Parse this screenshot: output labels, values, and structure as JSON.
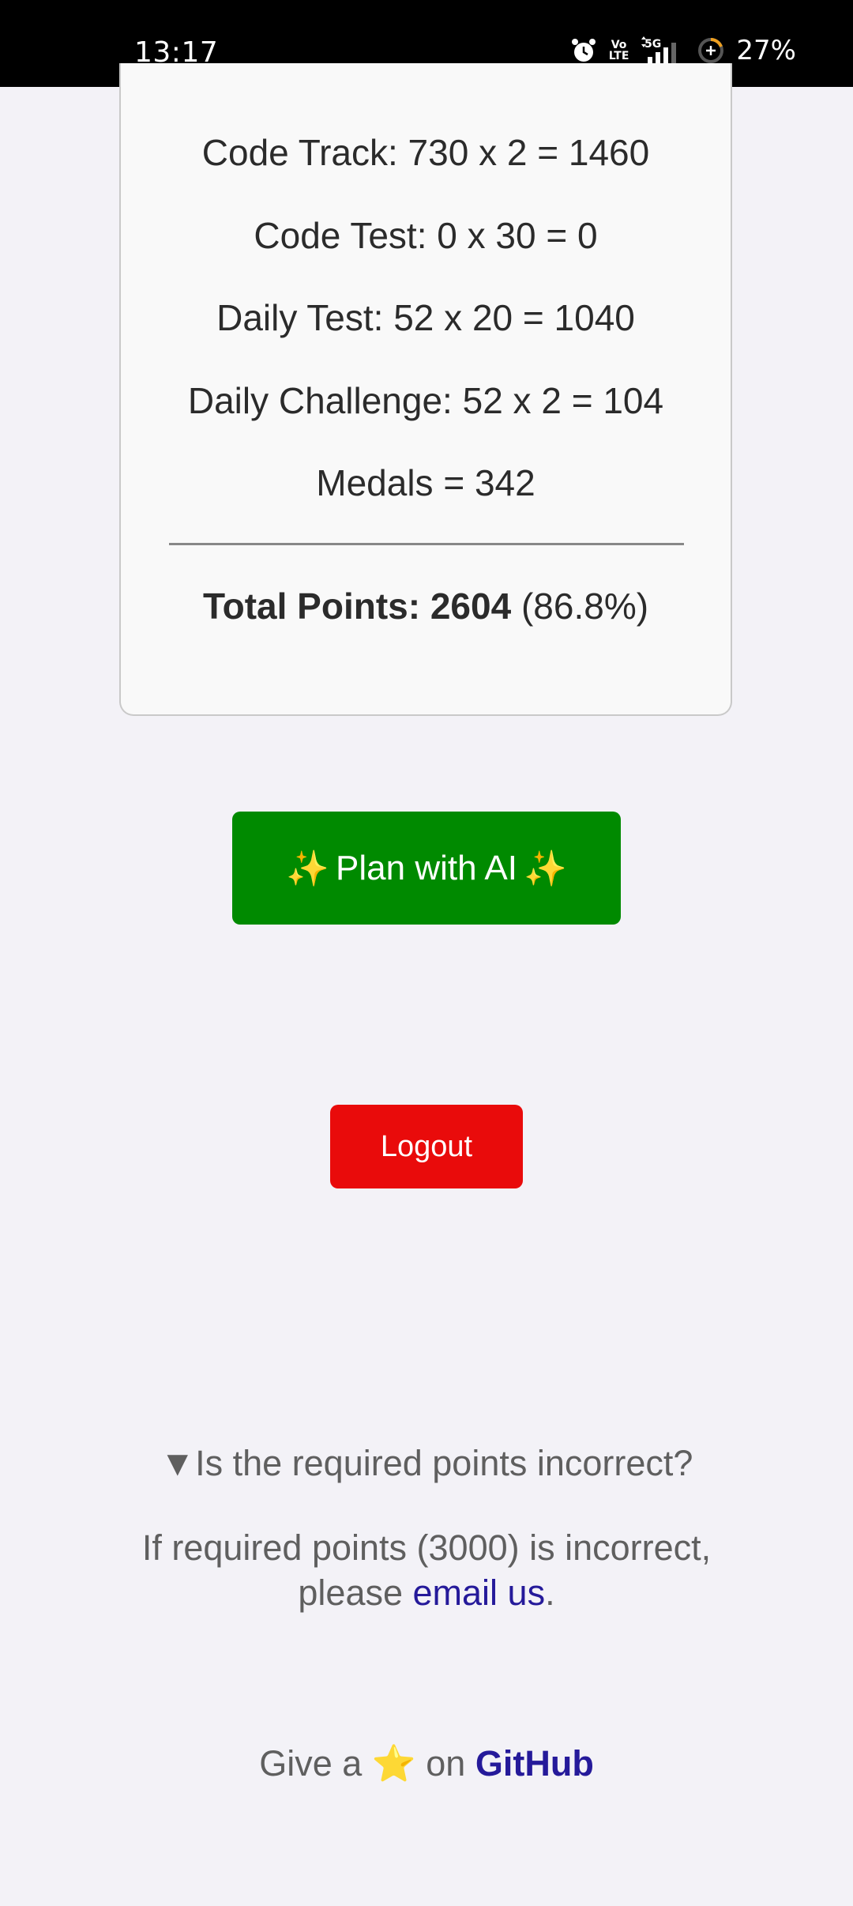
{
  "status_bar": {
    "time": "13:17",
    "volte_top": "Vo",
    "volte_bottom": "LTE",
    "network": "5G",
    "battery_percent": "27%",
    "icons": [
      "alarm-icon",
      "volte-icon",
      "signal-icon",
      "battery-icon"
    ]
  },
  "points": {
    "code_track": "Code Track: 730 x 2 = 1460",
    "code_test": "Code Test: 0 x 30 = 0",
    "daily_test": "Daily Test: 52 x 20 = 1040",
    "daily_challenge": "Daily Challenge: 52 x 2 = 104",
    "medals": "Medals = 342",
    "total_label": "Total Points: 2604",
    "total_percent": " (86.8%)"
  },
  "actions": {
    "plan_ai_sparkle": "✨",
    "plan_ai_label": " Plan with AI ",
    "logout_label": "Logout"
  },
  "help": {
    "summary_marker": "▼",
    "summary_text": "Is the required points incorrect?",
    "body_before": "If required points (3000) is incorrect, please ",
    "email_link": "email us",
    "body_after": "."
  },
  "footer": {
    "give_text": "Give a ",
    "star": "⭐",
    "on_text": " on ",
    "github_link": "GitHub"
  },
  "colors": {
    "background": "#f3f2f7",
    "ai_button": "#008a00",
    "logout_button": "#e90b0b",
    "link": "#251a9a"
  }
}
